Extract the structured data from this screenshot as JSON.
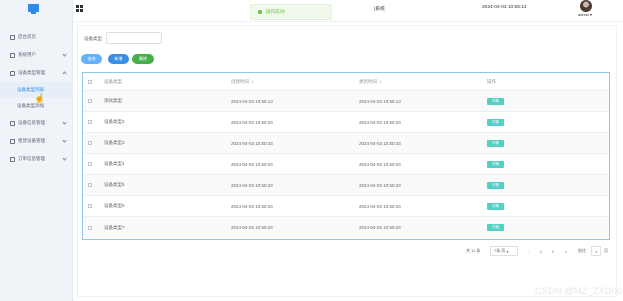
{
  "sidebar": {
    "items": [
      {
        "label": "后台首页"
      },
      {
        "label": "系统用户"
      },
      {
        "label": "设备类型管理"
      },
      {
        "label": "设备信息管理"
      },
      {
        "label": "租赁设备管理"
      },
      {
        "label": "订单信息管理"
      }
    ],
    "sub_items": [
      {
        "label": "设备类型列表"
      },
      {
        "label": "设备类型添加"
      }
    ]
  },
  "header": {
    "title_fragment": "|系统",
    "datetime": "2024-04-03 10:55:14",
    "user": "admin"
  },
  "toast": {
    "message": "操作成功!"
  },
  "search": {
    "label": "设备类型",
    "value": ""
  },
  "toolbar": {
    "query_label": "查询",
    "add_label": "新增",
    "delete_label": "删除"
  },
  "table": {
    "columns": {
      "name": "设备类型",
      "create": "创建时间",
      "update": "更新时间",
      "op": "操作"
    },
    "edit_label": "详情",
    "rows": [
      {
        "name": "测试类型",
        "create": "2024-04-03 10:55:13",
        "update": "2024-04-03 10:55:13"
      },
      {
        "name": "设备类型2",
        "create": "2024-04-03 10:50:43",
        "update": "2024-04-03 10:50:43"
      },
      {
        "name": "设备类型3",
        "create": "2024-04-03 10:50:43",
        "update": "2024-04-03 10:50:43"
      },
      {
        "name": "设备类型4",
        "create": "2024-04-03 10:50:43",
        "update": "2024-04-03 10:50:43"
      },
      {
        "name": "设备类型5",
        "create": "2024-04-03 10:50:43",
        "update": "2024-04-03 10:50:43"
      },
      {
        "name": "设备类型6",
        "create": "2024-04-03 10:50:43",
        "update": "2024-04-03 10:50:43"
      },
      {
        "name": "设备类型7",
        "create": "2024-04-03 10:50:43",
        "update": "2024-04-03 10:50:43"
      }
    ]
  },
  "pagination": {
    "total": "共 11 条",
    "page_size": "7条/页",
    "prev": "<",
    "page1": "1",
    "page2": "2",
    "next": ">",
    "goto": "前往",
    "jump_value": "1",
    "unit": "页"
  },
  "watermark": "CSDN @MZ_ZXD001",
  "colors": {
    "accent": "#2f89e6",
    "success": "#67c23a",
    "edit": "#4fd1c5",
    "delete": "#46b04b"
  }
}
